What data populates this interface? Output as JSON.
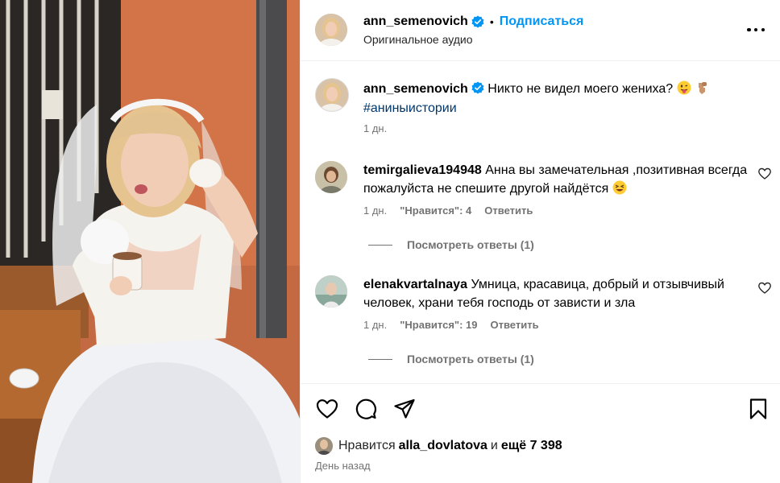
{
  "post": {
    "author": "ann_semenovich",
    "separator": "•",
    "follow_label": "Подписаться",
    "audio_label": "Оригинальное аудио"
  },
  "caption": {
    "username": "ann_semenovich",
    "text": "Никто не видел моего жениха?",
    "hashtag": "#аниныистории",
    "time": "1 дн."
  },
  "comments": [
    {
      "username": "temirgalieva194948",
      "text": "Анна вы замечательная ,позитивная всегда пожалуйста не спешите другой найдётся",
      "time": "1 дн.",
      "likes": "\"Нравится\": 4",
      "reply_label": "Ответить",
      "view_replies": "Посмотреть ответы (1)"
    },
    {
      "username": "elenakvartalnaya",
      "text": "Умница, красавица, добрый и отзывчивый человек, храни тебя господь от зависти и зла",
      "time": "1 дн.",
      "likes": "\"Нравится\": 19",
      "reply_label": "Ответить",
      "view_replies": "Посмотреть ответы (1)"
    }
  ],
  "likes": {
    "prefix": "Нравится",
    "user": "alla_dovlatova",
    "and": "и",
    "count": "ещё 7 398"
  },
  "date": "День назад",
  "icons": {
    "more": "more-options-icon",
    "like": "heart-icon",
    "comment": "comment-icon",
    "share": "share-icon",
    "save": "bookmark-icon",
    "verified": "verified-badge-icon"
  },
  "colors": {
    "accent": "#0095f6",
    "muted": "#737373",
    "hashtag": "#00376b"
  }
}
